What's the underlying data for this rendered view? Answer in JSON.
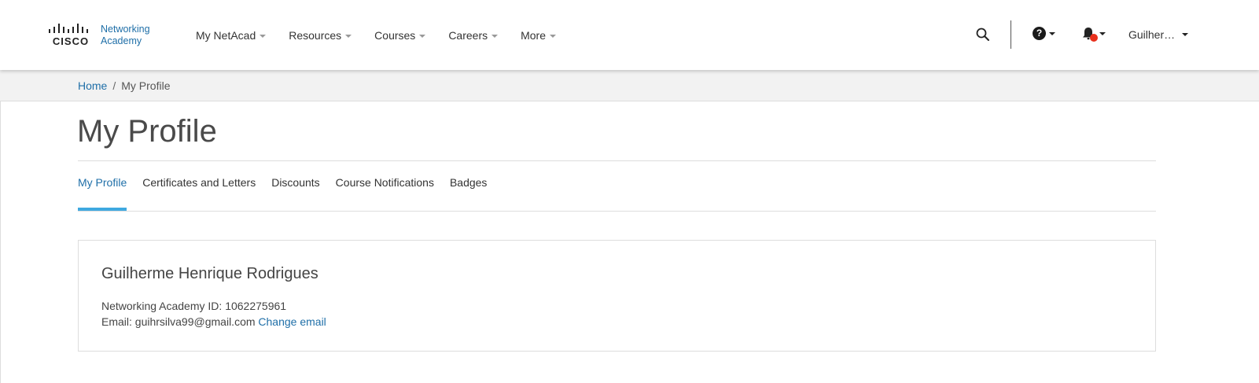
{
  "brand": {
    "name": "CISCO",
    "line1": "Networking",
    "line2": "Academy",
    "accent_color": "#1f6fa8"
  },
  "nav": {
    "items": [
      {
        "label": "My NetAcad"
      },
      {
        "label": "Resources"
      },
      {
        "label": "Courses"
      },
      {
        "label": "Careers"
      },
      {
        "label": "More"
      }
    ]
  },
  "header_actions": {
    "search_icon": "search-icon",
    "help_icon": "help-icon",
    "help_glyph": "?",
    "bell_icon": "bell-icon",
    "notification_dot_color": "#e8301c",
    "user_label": "Guilher…"
  },
  "breadcrumb": {
    "home": "Home",
    "separator": "/",
    "current": "My Profile"
  },
  "page": {
    "title": "My Profile"
  },
  "tabs": [
    {
      "label": "My Profile",
      "active": true
    },
    {
      "label": "Certificates and Letters",
      "active": false
    },
    {
      "label": "Discounts",
      "active": false
    },
    {
      "label": "Course Notifications",
      "active": false
    },
    {
      "label": "Badges",
      "active": false
    }
  ],
  "profile": {
    "name": "Guilherme Henrique Rodrigues",
    "id_label": "Networking Academy ID:",
    "id_value": "1062275961",
    "email_label": "Email:",
    "email_value": "guihrsilva99@gmail.com",
    "change_email": "Change email"
  },
  "colors": {
    "active_tab_underline": "#3fa9e0",
    "breadcrumb_bg": "#f2f2f2"
  }
}
